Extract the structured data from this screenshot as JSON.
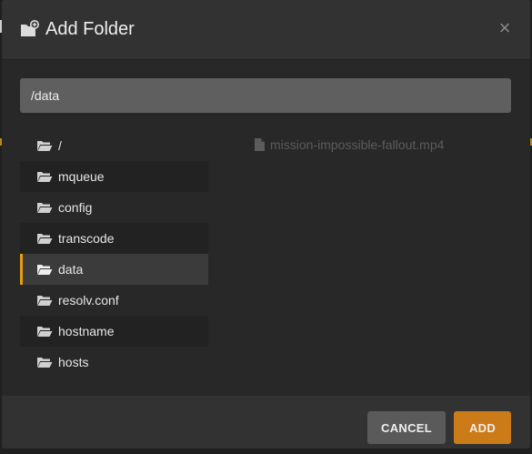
{
  "dialog": {
    "title": "Add Folder",
    "close_label": "×",
    "header_icon": "folder-add-icon"
  },
  "path_input": {
    "value": "/data"
  },
  "directories": [
    {
      "label": "/"
    },
    {
      "label": "mqueue"
    },
    {
      "label": "config"
    },
    {
      "label": "transcode"
    },
    {
      "label": "data",
      "selected": true
    },
    {
      "label": "resolv.conf"
    },
    {
      "label": "hostname"
    },
    {
      "label": "hosts"
    }
  ],
  "files": [
    {
      "label": "mission-impossible-fallout.mp4",
      "icon": "file-icon"
    }
  ],
  "footer": {
    "cancel_label": "CANCEL",
    "add_label": "ADD"
  },
  "colors": {
    "accent": "#e5a00d",
    "add_button": "#cc7b19",
    "cancel_button": "#5a5a5a",
    "dialog_bg": "#282828",
    "header_bg": "#323232"
  }
}
